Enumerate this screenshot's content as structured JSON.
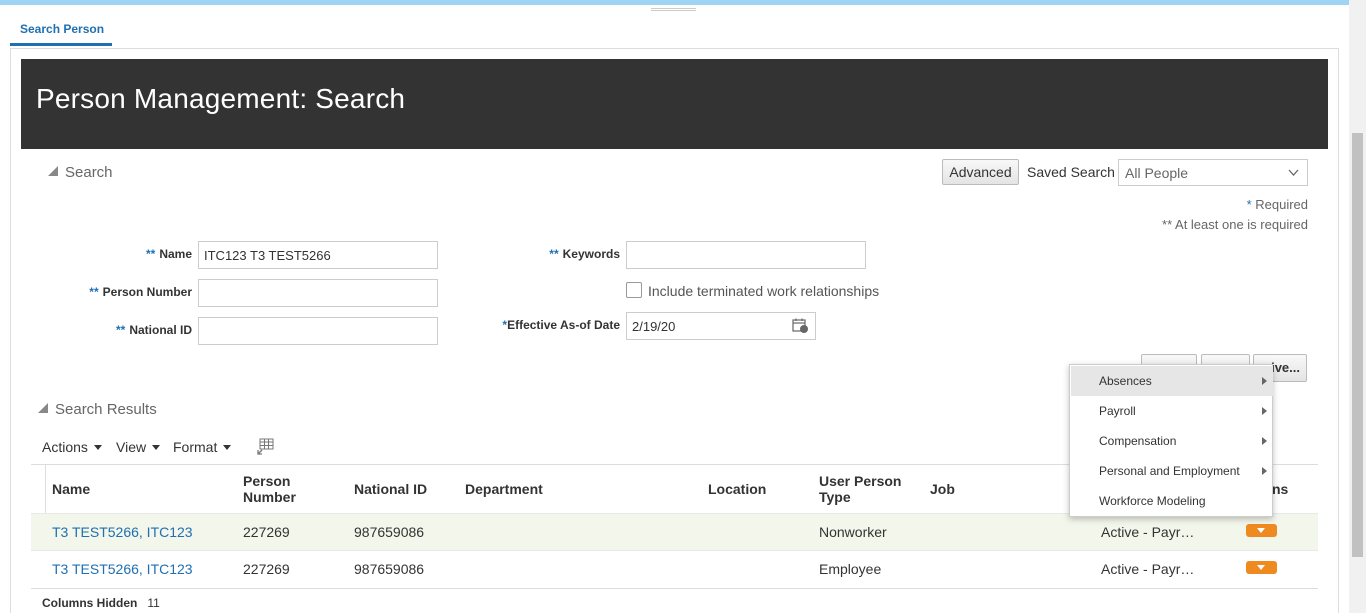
{
  "tab": {
    "label": "Search Person"
  },
  "header": {
    "title": "Person Management: Search"
  },
  "search": {
    "section_title": "Search",
    "advanced_label": "Advanced",
    "saved_search_label": "Saved Search",
    "saved_search_value": "All People",
    "required_note": "Required",
    "at_least_one_note": "** At least one is required",
    "fields": {
      "name_label": "Name",
      "name_value": "ITC123 T3 TEST5266",
      "person_number_label": "Person Number",
      "person_number_value": "",
      "national_id_label": "National ID",
      "national_id_value": "",
      "keywords_label": "Keywords",
      "keywords_value": "",
      "include_terminated_label": "Include terminated work relationships",
      "effective_date_label": "Effective As-of Date",
      "effective_date_value": "2/19/20"
    },
    "save_button_partial": "ive..."
  },
  "results": {
    "section_title": "Search Results",
    "toolbar": {
      "actions": "Actions",
      "view": "View",
      "format": "Format"
    },
    "columns": {
      "name": "Name",
      "person_number": "Person Number",
      "national_id": "National ID",
      "department": "Department",
      "location": "Location",
      "user_person_type": "User Person Type",
      "job": "Job",
      "actions_partial": "ns"
    },
    "rows": [
      {
        "name": "T3 TEST5266, ITC123",
        "person_number": "227269",
        "national_id": "987659086",
        "department": "",
        "location": "",
        "user_person_type": "Nonworker",
        "job": "",
        "status": "Active - Payr…"
      },
      {
        "name": "T3 TEST5266, ITC123",
        "person_number": "227269",
        "national_id": "987659086",
        "department": "",
        "location": "",
        "user_person_type": "Employee",
        "job": "",
        "status": "Active - Payr…"
      }
    ],
    "columns_hidden_label": "Columns Hidden",
    "columns_hidden_count": "11"
  },
  "context_menu": {
    "items": [
      "Absences",
      "Payroll",
      "Compensation",
      "Personal and Employment",
      "Workforce Modeling"
    ]
  },
  "colors": {
    "accent": "#1f6fb2",
    "header_bg": "#333333",
    "action_orange": "#ef8a21"
  },
  "icons": [
    "calendar-icon",
    "detach-table-icon",
    "dropdown-chevron-icon",
    "submenu-arrow-icon"
  ]
}
